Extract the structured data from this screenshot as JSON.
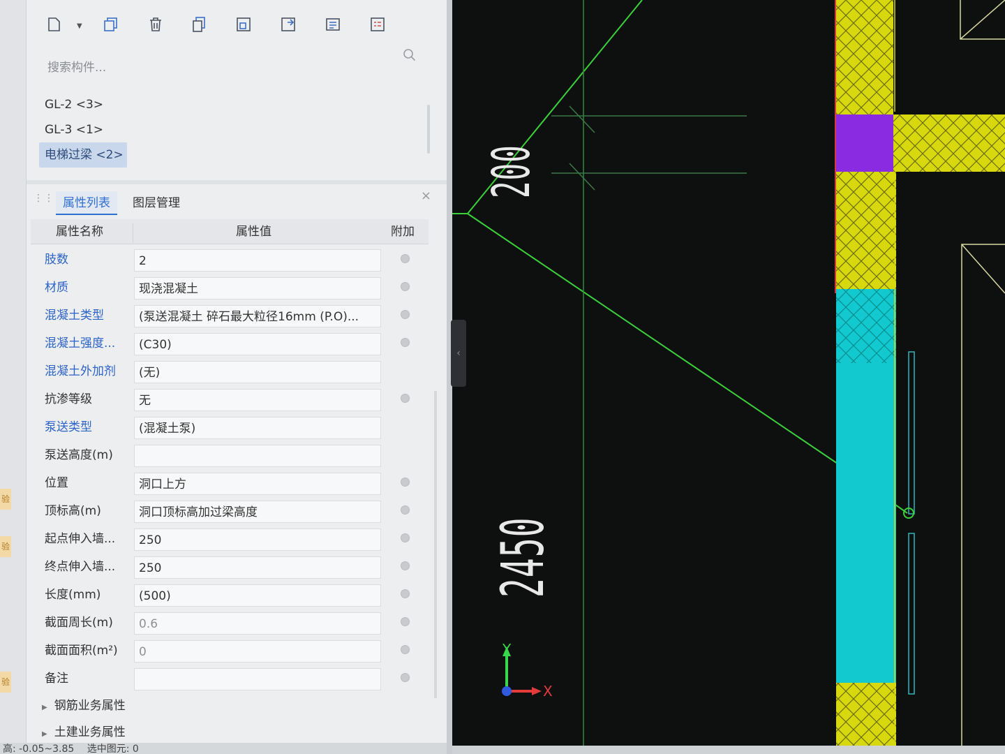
{
  "toolbar": {
    "icons": [
      "new-doc-icon",
      "copy-icon",
      "delete-icon",
      "layer-copy-icon",
      "floor-copy-icon",
      "export-icon",
      "list-icon",
      "report-icon"
    ]
  },
  "search": {
    "placeholder": "搜索构件..."
  },
  "components": [
    {
      "label": "GL-2 <3>",
      "selected": false
    },
    {
      "label": "GL-3 <1>",
      "selected": false
    },
    {
      "label": "电梯过梁 <2>",
      "selected": true
    }
  ],
  "tabs": {
    "active": "属性列表",
    "inactive": "图层管理"
  },
  "table": {
    "headers": {
      "name": "属性名称",
      "value": "属性值",
      "extra": "附加"
    },
    "rows": [
      {
        "name": "肢数",
        "value": "2",
        "blue": true,
        "check": true
      },
      {
        "name": "材质",
        "value": "现浇混凝土",
        "blue": true,
        "check": true
      },
      {
        "name": "混凝土类型",
        "value": "(泵送混凝土 碎石最大粒径16mm (P.O)...",
        "blue": true,
        "check": true
      },
      {
        "name": "混凝土强度...",
        "value": "(C30)",
        "blue": true,
        "check": true
      },
      {
        "name": "混凝土外加剂",
        "value": "(无)",
        "blue": true,
        "check": false
      },
      {
        "name": "抗渗等级",
        "value": "无",
        "blue": false,
        "check": true
      },
      {
        "name": "泵送类型",
        "value": "(混凝土泵)",
        "blue": true,
        "check": false
      },
      {
        "name": "泵送高度(m)",
        "value": "",
        "blue": false,
        "check": false
      },
      {
        "name": "位置",
        "value": "洞口上方",
        "blue": false,
        "check": true
      },
      {
        "name": "顶标高(m)",
        "value": "洞口顶标高加过梁高度",
        "blue": false,
        "check": true
      },
      {
        "name": "起点伸入墙...",
        "value": "250",
        "blue": false,
        "check": true
      },
      {
        "name": "终点伸入墙...",
        "value": "250",
        "blue": false,
        "check": true
      },
      {
        "name": "长度(mm)",
        "value": "(500)",
        "blue": false,
        "check": true
      },
      {
        "name": "截面周长(m)",
        "value": "0.6",
        "blue": false,
        "check": true,
        "gray": true
      },
      {
        "name": "截面面积(m²)",
        "value": "0",
        "blue": false,
        "check": true,
        "gray": true
      },
      {
        "name": "备注",
        "value": "",
        "blue": false,
        "check": true
      }
    ],
    "groups": [
      "钢筋业务属性",
      "土建业务属性"
    ]
  },
  "status": {
    "elevation": "高: -0.05~3.85",
    "selected": "选中图元: 0"
  },
  "edge_buttons": [
    "验",
    "验",
    "验"
  ],
  "canvas": {
    "dim_200": "200",
    "dim_2450": "2450",
    "axis_y": "Y",
    "axis_x": "X",
    "colors": {
      "line": "#3bd13b",
      "yellow": "#d8d80e",
      "purple": "#8a2be2",
      "cyan": "#12c9cf",
      "background": "#0e0f0f"
    }
  }
}
